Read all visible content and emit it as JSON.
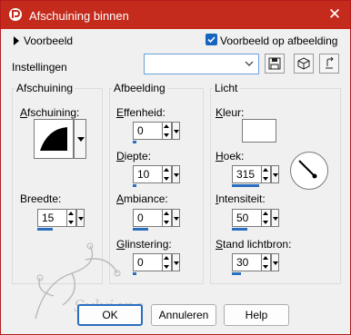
{
  "window": {
    "title": "Afschuining binnen",
    "title_bg": "#c42b1c",
    "close_glyph": "✕"
  },
  "top": {
    "preview_label": "Voorbeeld",
    "preview_on_image_label": "Voorbeeld op afbeelding",
    "preview_on_image_checked": true
  },
  "settings": {
    "label": "Instellingen",
    "selected_value": "",
    "icons": [
      "save-icon",
      "cube-icon",
      "reset-icon"
    ]
  },
  "groups": {
    "afschuining": {
      "title": "Afschuining",
      "shape_label_u": "A",
      "shape_label_rest": "fschuining:",
      "breedte_label": "Breedte:",
      "breedte_value": "15",
      "breedte_fraction": 0.5
    },
    "afbeelding": {
      "title": "Afbeelding",
      "effenheid_label_u": "E",
      "effenheid_label_rest": "ffenheid:",
      "effenheid_value": "0",
      "effenheid_fraction": 0.0,
      "diepte_label_u": "D",
      "diepte_label_rest": "iepte:",
      "diepte_value": "10",
      "diepte_fraction": 0.1,
      "ambiance_label_u": "A",
      "ambiance_label_rest": "mbiance:",
      "ambiance_value": "0",
      "ambiance_fraction": 0.5,
      "glinstering_label_u": "G",
      "glinstering_label_rest": "linstering:",
      "glinstering_value": "0",
      "glinstering_fraction": 0.0
    },
    "licht": {
      "title": "Licht",
      "kleur_label_u": "K",
      "kleur_label_rest": "leur:",
      "hoek_label_u": "H",
      "hoek_label_rest": "oek:",
      "hoek_value": "315",
      "hoek_fraction": 0.875,
      "intensiteit_label_u": "I",
      "intensiteit_label_rest": "ntensiteit:",
      "intensiteit_value": "50",
      "intensiteit_fraction": 0.5,
      "lichtbron_label_u": "S",
      "lichtbron_label_rest": "tand lichtbron:",
      "lichtbron_value": "30",
      "lichtbron_fraction": 0.3
    }
  },
  "buttons": {
    "ok": "OK",
    "cancel": "Annuleren",
    "help": "Help"
  },
  "watermark_text": "Sylviane"
}
